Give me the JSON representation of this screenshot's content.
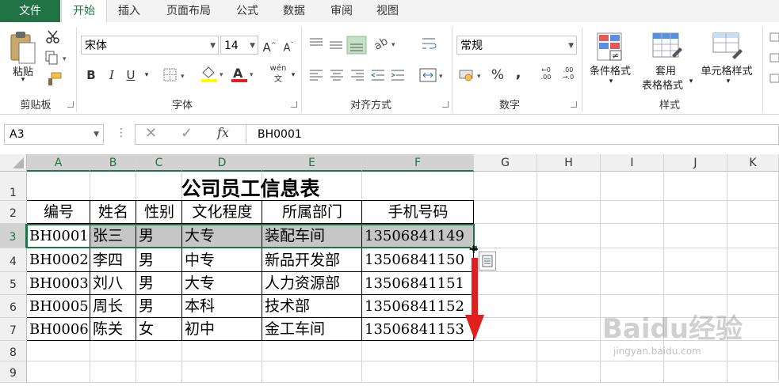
{
  "tabs": [
    "文件",
    "开始",
    "插入",
    "页面布局",
    "公式",
    "数据",
    "审阅",
    "视图"
  ],
  "active_tab": "开始",
  "ribbon": {
    "clipboard": {
      "paste_label": "粘贴",
      "group_label": "剪贴板"
    },
    "font": {
      "font_name": "宋体",
      "font_size": "14",
      "group_label": "字体",
      "bold": "B",
      "italic": "I",
      "underline": "U",
      "phonetic": "wén"
    },
    "alignment": {
      "group_label": "对齐方式"
    },
    "number": {
      "format": "常规",
      "group_label": "数字",
      "percent": "%",
      "comma": ","
    },
    "styles": {
      "conditional_format": "条件格式",
      "format_as_table_1": "套用",
      "format_as_table_2": "表格格式",
      "cell_styles": "单元格样式",
      "group_label": "样式"
    }
  },
  "formula_bar": {
    "name_box": "A3",
    "fx": "fx",
    "value": "BH0001"
  },
  "columns": [
    "A",
    "B",
    "C",
    "D",
    "E",
    "F",
    "G",
    "H",
    "I",
    "J",
    "K"
  ],
  "rows": [
    "1",
    "2",
    "3",
    "4",
    "5",
    "6",
    "7",
    "8",
    "9"
  ],
  "sheet": {
    "title": "公司员工信息表",
    "headers": [
      "编号",
      "姓名",
      "性别",
      "文化程度",
      "所属部门",
      "手机号码"
    ],
    "records": [
      [
        "BH0001",
        "张三",
        "男",
        "大专",
        "装配车间",
        "13506841149"
      ],
      [
        "BH0002",
        "李四",
        "男",
        "中专",
        "新品开发部",
        "13506841150"
      ],
      [
        "BH0003",
        "刘八",
        "男",
        "大专",
        "人力资源部",
        "13506841151"
      ],
      [
        "BH0005",
        "周长",
        "男",
        "本科",
        "技术部",
        "13506841152"
      ],
      [
        "BH0006",
        "陈关",
        "女",
        "初中",
        "金工车间",
        "13506841153"
      ]
    ]
  },
  "colors": {
    "accent": "#217346",
    "arrow": "#e02020",
    "selection": "#c6c6c6"
  },
  "watermark": {
    "brand": "Baidu经验",
    "url": "jingyan.baidu.com"
  }
}
